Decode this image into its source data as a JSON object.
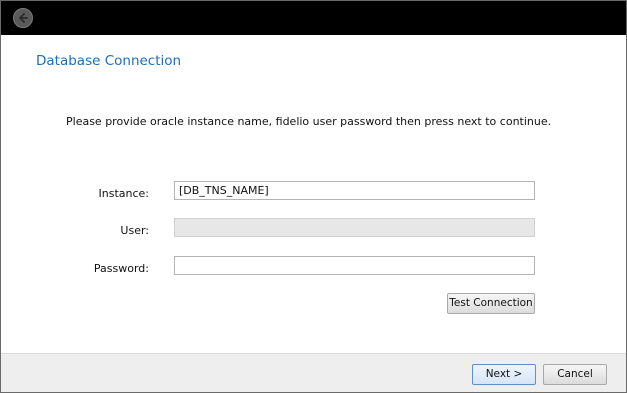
{
  "window": {
    "back_icon": "arrow-left-icon"
  },
  "page": {
    "title": "Database Connection",
    "instructions": "Please provide oracle instance name, fidelio user password then press next to continue."
  },
  "form": {
    "instance_label": "Instance:",
    "instance_value": "[DB_TNS_NAME]",
    "user_label": "User:",
    "user_value": "",
    "password_label": "Password:",
    "password_value": "",
    "test_connection_label": "Test Connection"
  },
  "footer": {
    "next_label": "Next >",
    "cancel_label": "Cancel"
  }
}
